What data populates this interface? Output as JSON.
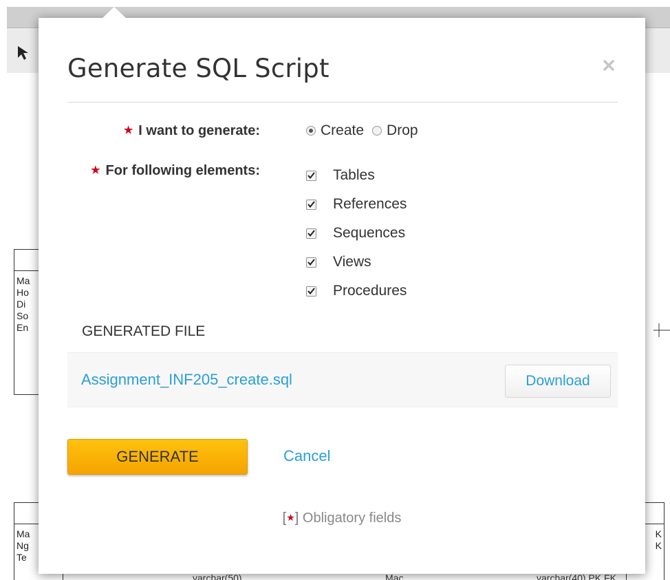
{
  "background": {
    "table_rows_1": [
      "Ma",
      "Ho",
      "Di",
      "So",
      "En"
    ],
    "table_rows_2": [
      "Ma",
      "Ng",
      "Te"
    ],
    "table_rows_3": [
      "",
      "K",
      "K"
    ],
    "bottom_texts": [
      "varchar(50)",
      "Mac",
      "varchar(40) PK FK"
    ]
  },
  "dialog": {
    "title": "Generate SQL Script",
    "close_icon": "close-icon",
    "generate_label": "I want to generate:",
    "radio_options": [
      {
        "label": "Create",
        "selected": true
      },
      {
        "label": "Drop",
        "selected": false
      }
    ],
    "elements_label": "For following elements:",
    "checkboxes": [
      {
        "label": "Tables",
        "checked": true
      },
      {
        "label": "References",
        "checked": true
      },
      {
        "label": "Sequences",
        "checked": true
      },
      {
        "label": "Views",
        "checked": true
      },
      {
        "label": "Procedures",
        "checked": true
      }
    ],
    "generated_file_heading": "GENERATED FILE",
    "file_name": "Assignment_INF205_create.sql",
    "download_label": "Download",
    "generate_button": "GENERATE",
    "cancel_label": "Cancel",
    "footnote": "Obligatory fields",
    "accent_color": "#2a9fd6",
    "primary_button_color": "#f5b301",
    "required_color": "#d0021b"
  }
}
